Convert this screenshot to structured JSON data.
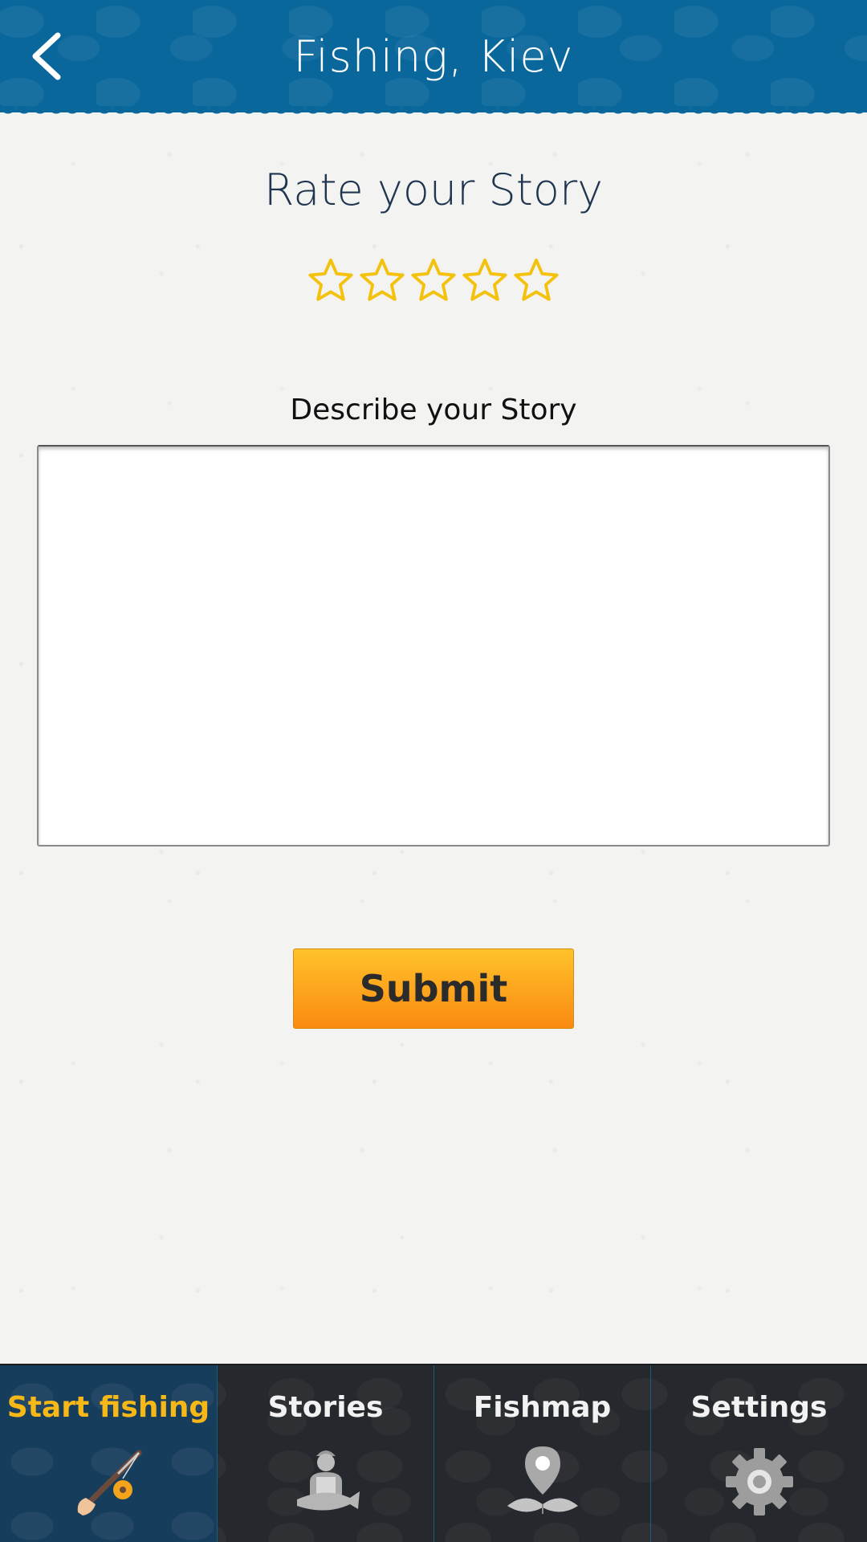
{
  "header": {
    "title": "Fishing, Kiev",
    "back_icon": "chevron-left-icon"
  },
  "rating": {
    "title": "Rate your Story",
    "max_stars": 5,
    "selected": 0,
    "star_color": "#f4c20d"
  },
  "story": {
    "label": "Describe your Story",
    "value": "",
    "placeholder": ""
  },
  "submit": {
    "label": "Submit"
  },
  "nav": {
    "items": [
      {
        "label": "Start fishing",
        "icon": "fishing-rod-icon",
        "active": true
      },
      {
        "label": "Stories",
        "icon": "fisherman-icon",
        "active": false
      },
      {
        "label": "Fishmap",
        "icon": "map-pin-fish-icon",
        "active": false
      },
      {
        "label": "Settings",
        "icon": "gear-icon",
        "active": false
      }
    ],
    "active_color": "#f6b817"
  },
  "colors": {
    "header_bg": "#0a679b",
    "nav_bg": "#25282c",
    "nav_active_bg": "#173d5c",
    "button_gradient": [
      "#ffc22a",
      "#fb8a12"
    ]
  }
}
